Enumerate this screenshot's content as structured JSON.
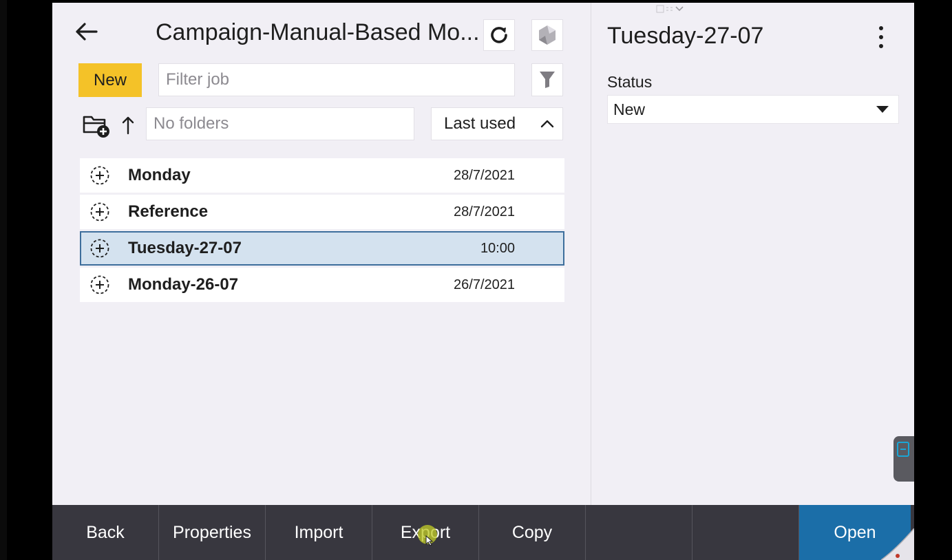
{
  "header": {
    "title": "Campaign-Manual-Based Mo..."
  },
  "toolbar": {
    "new_label": "New",
    "filter_placeholder": "Filter job",
    "folder_placeholder": "No folders",
    "sort_label": "Last used"
  },
  "jobs": [
    {
      "name": "Monday",
      "date": "28/7/2021",
      "selected": false
    },
    {
      "name": "Reference",
      "date": "28/7/2021",
      "selected": false
    },
    {
      "name": "Tuesday-27-07",
      "date": "10:00",
      "selected": true
    },
    {
      "name": "Monday-26-07",
      "date": "26/7/2021",
      "selected": false
    }
  ],
  "details": {
    "title": "Tuesday-27-07",
    "status_label": "Status",
    "status_value": "New"
  },
  "bottom_bar": {
    "back": "Back",
    "properties": "Properties",
    "import": "Import",
    "export": "Export",
    "copy": "Copy",
    "open": "Open"
  },
  "icons": {
    "back": "arrow-left-icon",
    "refresh": "refresh-icon",
    "app": "app-logo-icon",
    "filter": "funnel-icon",
    "new_folder": "folder-add-icon",
    "up": "arrow-up-icon",
    "sort": "chevron-up-icon",
    "job": "add-circle-dashed-icon",
    "more": "kebab-menu-icon",
    "dropdown": "caret-down-icon"
  },
  "colors": {
    "new_button": "#f4c228",
    "selected_row": "#d4e2ef",
    "selected_border": "#3d6e9c",
    "bottom_bar": "#38373f",
    "open_button": "#1b6ea8",
    "background": "#f1eff5"
  }
}
